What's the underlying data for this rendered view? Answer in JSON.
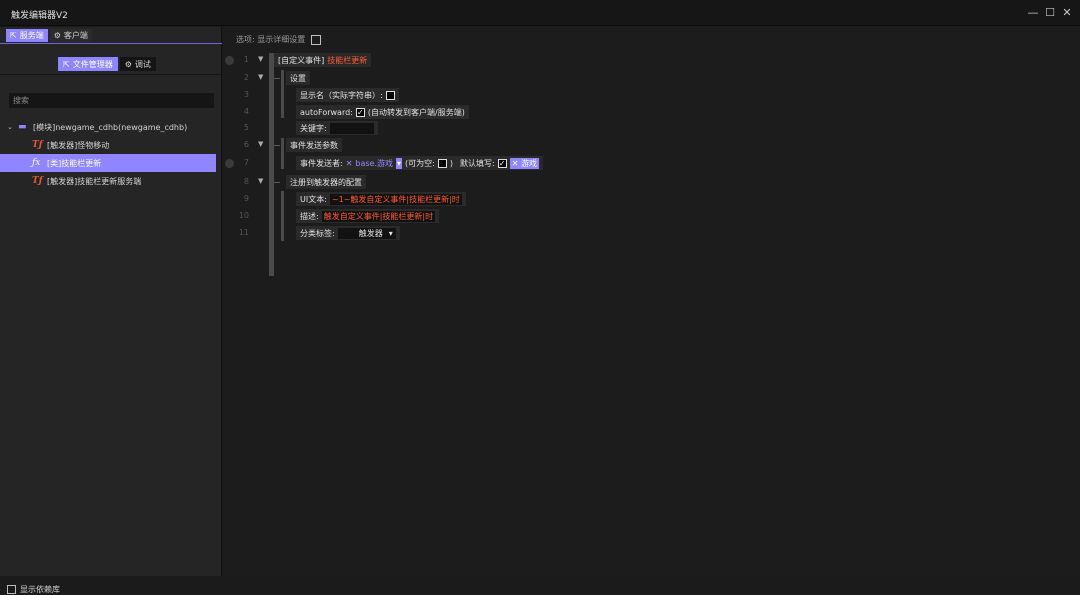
{
  "window": {
    "title": "触发编辑器V2",
    "controls": {
      "minimize": "—",
      "maximize": "☐",
      "close": "✕"
    }
  },
  "left": {
    "tabs": [
      {
        "label": "服务端",
        "icon": "server-cursor-icon",
        "active": true
      },
      {
        "label": "客户端",
        "icon": "client-icon",
        "active": false
      }
    ],
    "subtabs": [
      {
        "label": "文件管理器",
        "icon": "file-manager-icon",
        "active": true
      },
      {
        "label": "调试",
        "icon": "debug-icon",
        "active": false
      }
    ],
    "search_placeholder": "搜索",
    "tree": {
      "module": "[模块]newgame_cdhb(newgame_cdhb)",
      "items": [
        {
          "icon": "Tƒ",
          "label": "[触发器]怪物移动",
          "selected": false
        },
        {
          "icon": "ƒx",
          "label": "[类]技能栏更新",
          "selected": true
        },
        {
          "icon": "Tƒ",
          "label": "[触发器]技能栏更新服务端",
          "selected": false
        }
      ]
    },
    "show_deps_label": "显示依赖库"
  },
  "main": {
    "options_label": "选项: 显示详细设置",
    "lines": {
      "n1": "1",
      "n2": "2",
      "n3": "3",
      "n4": "4",
      "n5": "5",
      "n6": "6",
      "n7": "7",
      "n8": "8",
      "n9": "9",
      "n10": "10",
      "n11": "11"
    },
    "event_prefix": "[自定义事件]",
    "event_name": "技能栏更新",
    "settings": "设置",
    "display_name_label": "显示名（实际字符串）:",
    "autoforward_label": "autoForward:",
    "autoforward_hint": "(自动转发到客户端/服务端)",
    "keyword_label": "关键字:",
    "params_label": "事件发送参数",
    "sender_label": "事件发送者:",
    "sender_type": "base.游戏",
    "nullable_label": "(可为空:",
    "nullable_close": ")",
    "default_label": "默认填写:",
    "default_value": "游戏",
    "register_label": "注册到触发器的配置",
    "ui_text_label": "UI文本:",
    "ui_text_value": "~1~触发自定义事件|技能栏更新|时",
    "desc_label": "描述:",
    "desc_value": "触发自定义事件|技能栏更新|时",
    "category_label": "分类标签:",
    "category_value": "触发器"
  }
}
